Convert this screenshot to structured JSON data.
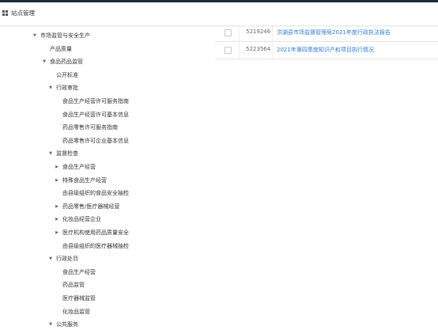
{
  "header": {
    "title": "站点管理",
    "menu_icon": "grid-icon"
  },
  "tree": [
    {
      "label": "市场监管与安全生产",
      "depth": 1,
      "expandable": true,
      "expanded": true
    },
    {
      "label": "产品质量",
      "depth": 2,
      "expandable": false
    },
    {
      "label": "食品药品监管",
      "depth": 2,
      "expandable": true,
      "expanded": true
    },
    {
      "label": "公开标准",
      "depth": 3,
      "expandable": false
    },
    {
      "label": "行政审批",
      "depth": 3,
      "expandable": true,
      "expanded": true
    },
    {
      "label": "食品生产经营许可服务指南",
      "depth": 4,
      "expandable": false
    },
    {
      "label": "食品生产经营许可基本信息",
      "depth": 4,
      "expandable": false
    },
    {
      "label": "药品零售许可服务指南",
      "depth": 4,
      "expandable": false
    },
    {
      "label": "药品零售许可企业基本信息",
      "depth": 4,
      "expandable": false
    },
    {
      "label": "监督检查",
      "depth": 3,
      "expandable": true,
      "expanded": true
    },
    {
      "label": "食品生产经营",
      "depth": 4,
      "expandable": true,
      "expanded": false
    },
    {
      "label": "特殊食品生产经营",
      "depth": 4,
      "expandable": true,
      "expanded": false
    },
    {
      "label": "由县级组织的食品安全抽检",
      "depth": 4,
      "expandable": false
    },
    {
      "label": "药品零售/医疗器械经营",
      "depth": 4,
      "expandable": true,
      "expanded": false
    },
    {
      "label": "化妆品经营企业",
      "depth": 4,
      "expandable": true,
      "expanded": false
    },
    {
      "label": "医疗机构使用药品质量安全",
      "depth": 4,
      "expandable": true,
      "expanded": false
    },
    {
      "label": "由县级组织的医疗器械抽检",
      "depth": 4,
      "expandable": false
    },
    {
      "label": "行政处罚",
      "depth": 3,
      "expandable": true,
      "expanded": true
    },
    {
      "label": "食品生产经营",
      "depth": 4,
      "expandable": false
    },
    {
      "label": "药品监管",
      "depth": 4,
      "expandable": false
    },
    {
      "label": "医疗器械监管",
      "depth": 4,
      "expandable": false
    },
    {
      "label": "化妆品监管",
      "depth": 4,
      "expandable": false
    },
    {
      "label": "公共服务",
      "depth": 3,
      "expandable": true,
      "expanded": true
    }
  ],
  "articles": [
    {
      "id": "5219246",
      "title": "洪湖县市场监督管理局2021年度行政执法报告",
      "checked": false
    },
    {
      "id": "5223564",
      "title": "2021年第四季度知识产权项目执行情况",
      "checked": false
    }
  ],
  "colors": {
    "link": "#2e7dd6",
    "topbar": "#1f2a3c"
  }
}
